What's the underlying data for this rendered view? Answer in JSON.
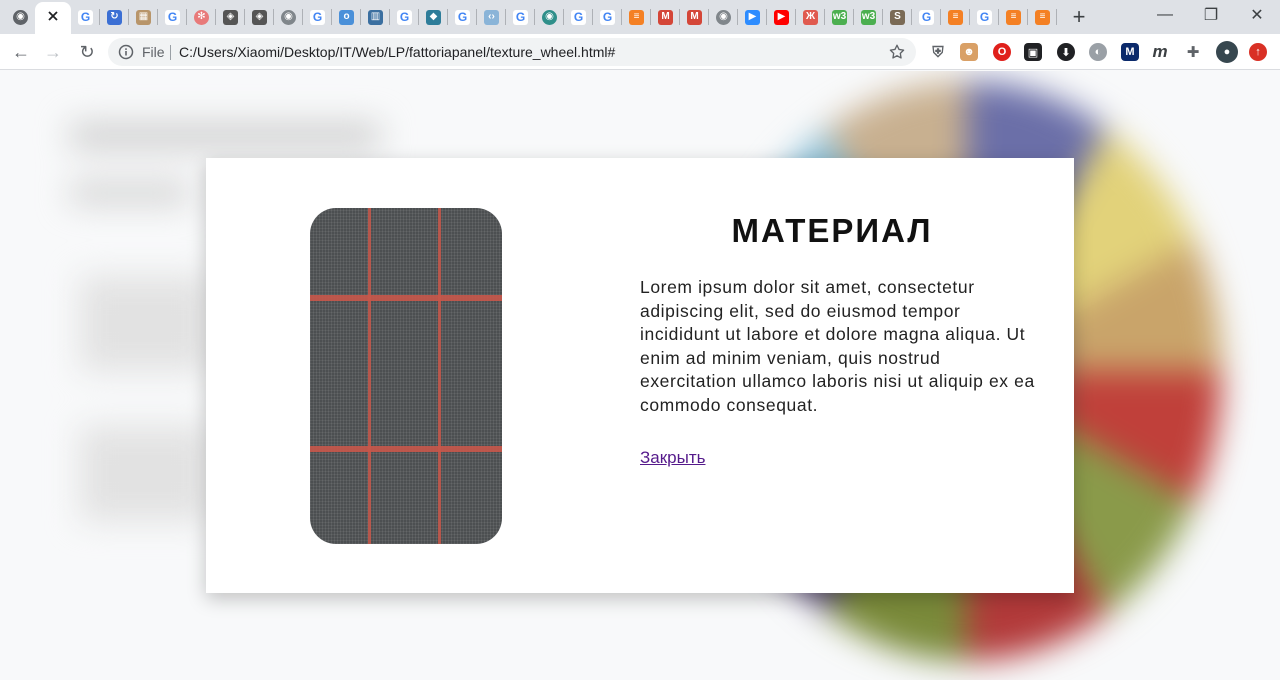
{
  "browser": {
    "tabs": [
      {
        "icon": "globe-icon",
        "color": "#5f6368",
        "glyph": "◉"
      },
      {
        "icon": "close-icon",
        "active": true
      },
      {
        "icon": "google-icon",
        "color": "#4285f4",
        "glyph": "G"
      },
      {
        "icon": "sync-icon",
        "color": "#3b6fd4",
        "glyph": "↻"
      },
      {
        "icon": "image-icon",
        "color": "#b8956a",
        "glyph": "▦"
      },
      {
        "icon": "google-icon",
        "color": "#4285f4",
        "glyph": "G"
      },
      {
        "icon": "flower-icon",
        "color": "#e87a7a",
        "glyph": "✻"
      },
      {
        "icon": "cube-icon",
        "color": "#555555",
        "glyph": "◈"
      },
      {
        "icon": "cube-icon",
        "color": "#555555",
        "glyph": "◈"
      },
      {
        "icon": "globe-icon",
        "color": "#80868b",
        "glyph": "◉"
      },
      {
        "icon": "google-icon",
        "color": "#4285f4",
        "glyph": "G"
      },
      {
        "icon": "ring-icon",
        "color": "#4a90d9",
        "glyph": "o"
      },
      {
        "icon": "chart-icon",
        "color": "#3b6fa0",
        "glyph": "▥"
      },
      {
        "icon": "google-icon",
        "color": "#4285f4",
        "glyph": "G"
      },
      {
        "icon": "bird-icon",
        "color": "#2e7d9a",
        "glyph": "◆"
      },
      {
        "icon": "google-icon",
        "color": "#4285f4",
        "glyph": "G"
      },
      {
        "icon": "code-icon",
        "color": "#8ab4d8",
        "glyph": "‹›"
      },
      {
        "icon": "google-icon",
        "color": "#4285f4",
        "glyph": "G"
      },
      {
        "icon": "sphere-icon",
        "color": "#2f8f8a",
        "glyph": "◉"
      },
      {
        "icon": "google-icon",
        "color": "#4285f4",
        "glyph": "G"
      },
      {
        "icon": "google-icon",
        "color": "#4285f4",
        "glyph": "G"
      },
      {
        "icon": "stack-icon",
        "color": "#f48024",
        "glyph": "≡"
      },
      {
        "icon": "gmail-icon",
        "color": "#d44638",
        "glyph": "M"
      },
      {
        "icon": "gmail-icon",
        "color": "#d44638",
        "glyph": "M"
      },
      {
        "icon": "globe-icon",
        "color": "#80868b",
        "glyph": "◉"
      },
      {
        "icon": "zoom-icon",
        "color": "#2d8cff",
        "glyph": "▶"
      },
      {
        "icon": "youtube-icon",
        "color": "#ff0000",
        "glyph": "▶"
      },
      {
        "icon": "tower-icon",
        "color": "#e05a4f",
        "glyph": "Ж"
      },
      {
        "icon": "w3-icon",
        "color": "#4caf50",
        "glyph": "w3"
      },
      {
        "icon": "w3-icon",
        "color": "#4caf50",
        "glyph": "w3"
      },
      {
        "icon": "coin-icon",
        "color": "#7a6a55",
        "glyph": "S"
      },
      {
        "icon": "google-icon",
        "color": "#4285f4",
        "glyph": "G"
      },
      {
        "icon": "stack-icon",
        "color": "#f48024",
        "glyph": "≡"
      },
      {
        "icon": "google-icon",
        "color": "#4285f4",
        "glyph": "G"
      },
      {
        "icon": "stack-icon",
        "color": "#f48024",
        "glyph": "≡"
      },
      {
        "icon": "stack-icon",
        "color": "#f48024",
        "glyph": "≡"
      }
    ],
    "new_tab_glyph": "+",
    "window": {
      "minimize": "—",
      "restore": "❐",
      "close": "✕"
    },
    "nav": {
      "back": "←",
      "forward": "→",
      "reload": "↻"
    },
    "omnibox": {
      "scheme_label": "File",
      "url": "C:/Users/Xiaomi/Desktop/IT/Web/LP/fattoriapanel/texture_wheel.html#"
    },
    "extensions": [
      {
        "icon": "shield-icon",
        "color": "#5f6368",
        "glyph": "⛨"
      },
      {
        "icon": "fox-icon",
        "color": "#d9a066",
        "glyph": "☻"
      },
      {
        "icon": "opera-icon",
        "color": "#e0201b",
        "glyph": "O"
      },
      {
        "icon": "puzzle-dark-icon",
        "color": "#202124",
        "glyph": "▣"
      },
      {
        "icon": "download-icon",
        "color": "#202124",
        "glyph": "⬇"
      },
      {
        "icon": "mask-icon",
        "color": "#9aa0a6",
        "glyph": "◐"
      },
      {
        "icon": "m-square-icon",
        "color": "#0b2a6b",
        "glyph": "M"
      },
      {
        "icon": "m-italic-icon",
        "color": "#3c4043",
        "glyph": "m"
      },
      {
        "icon": "puzzle-icon",
        "color": "#5f6368",
        "glyph": "✚"
      },
      {
        "icon": "avatar-icon",
        "color": "#37474f",
        "glyph": "●"
      },
      {
        "icon": "update-icon",
        "color": "#d93025",
        "glyph": "↑"
      }
    ]
  },
  "modal": {
    "title": "МАТЕРИАЛ",
    "description": "Lorem ipsum dolor sit amet, consectetur adipiscing elit, sed do eiusmod tempor incididunt ut labore et dolore magna aliqua. Ut enim ad minim veniam, quis nostrud exercitation ullamco laboris nisi ut aliquip ex ea commodo consequat.",
    "close_link": "Закрыть"
  },
  "colors": {
    "fabric_base": "#55585a",
    "fabric_stripe": "#c8574a",
    "link_visited": "#551a8b",
    "wheel": [
      "#6b6fa8",
      "#e2d27a",
      "#c9a46a",
      "#c0403a",
      "#8a9a4a",
      "#b23a3a",
      "#7a8a3a",
      "#5a4a7a",
      "#3a3a3a",
      "#6a8ab0",
      "#8cc0d8",
      "#c8b090"
    ]
  }
}
